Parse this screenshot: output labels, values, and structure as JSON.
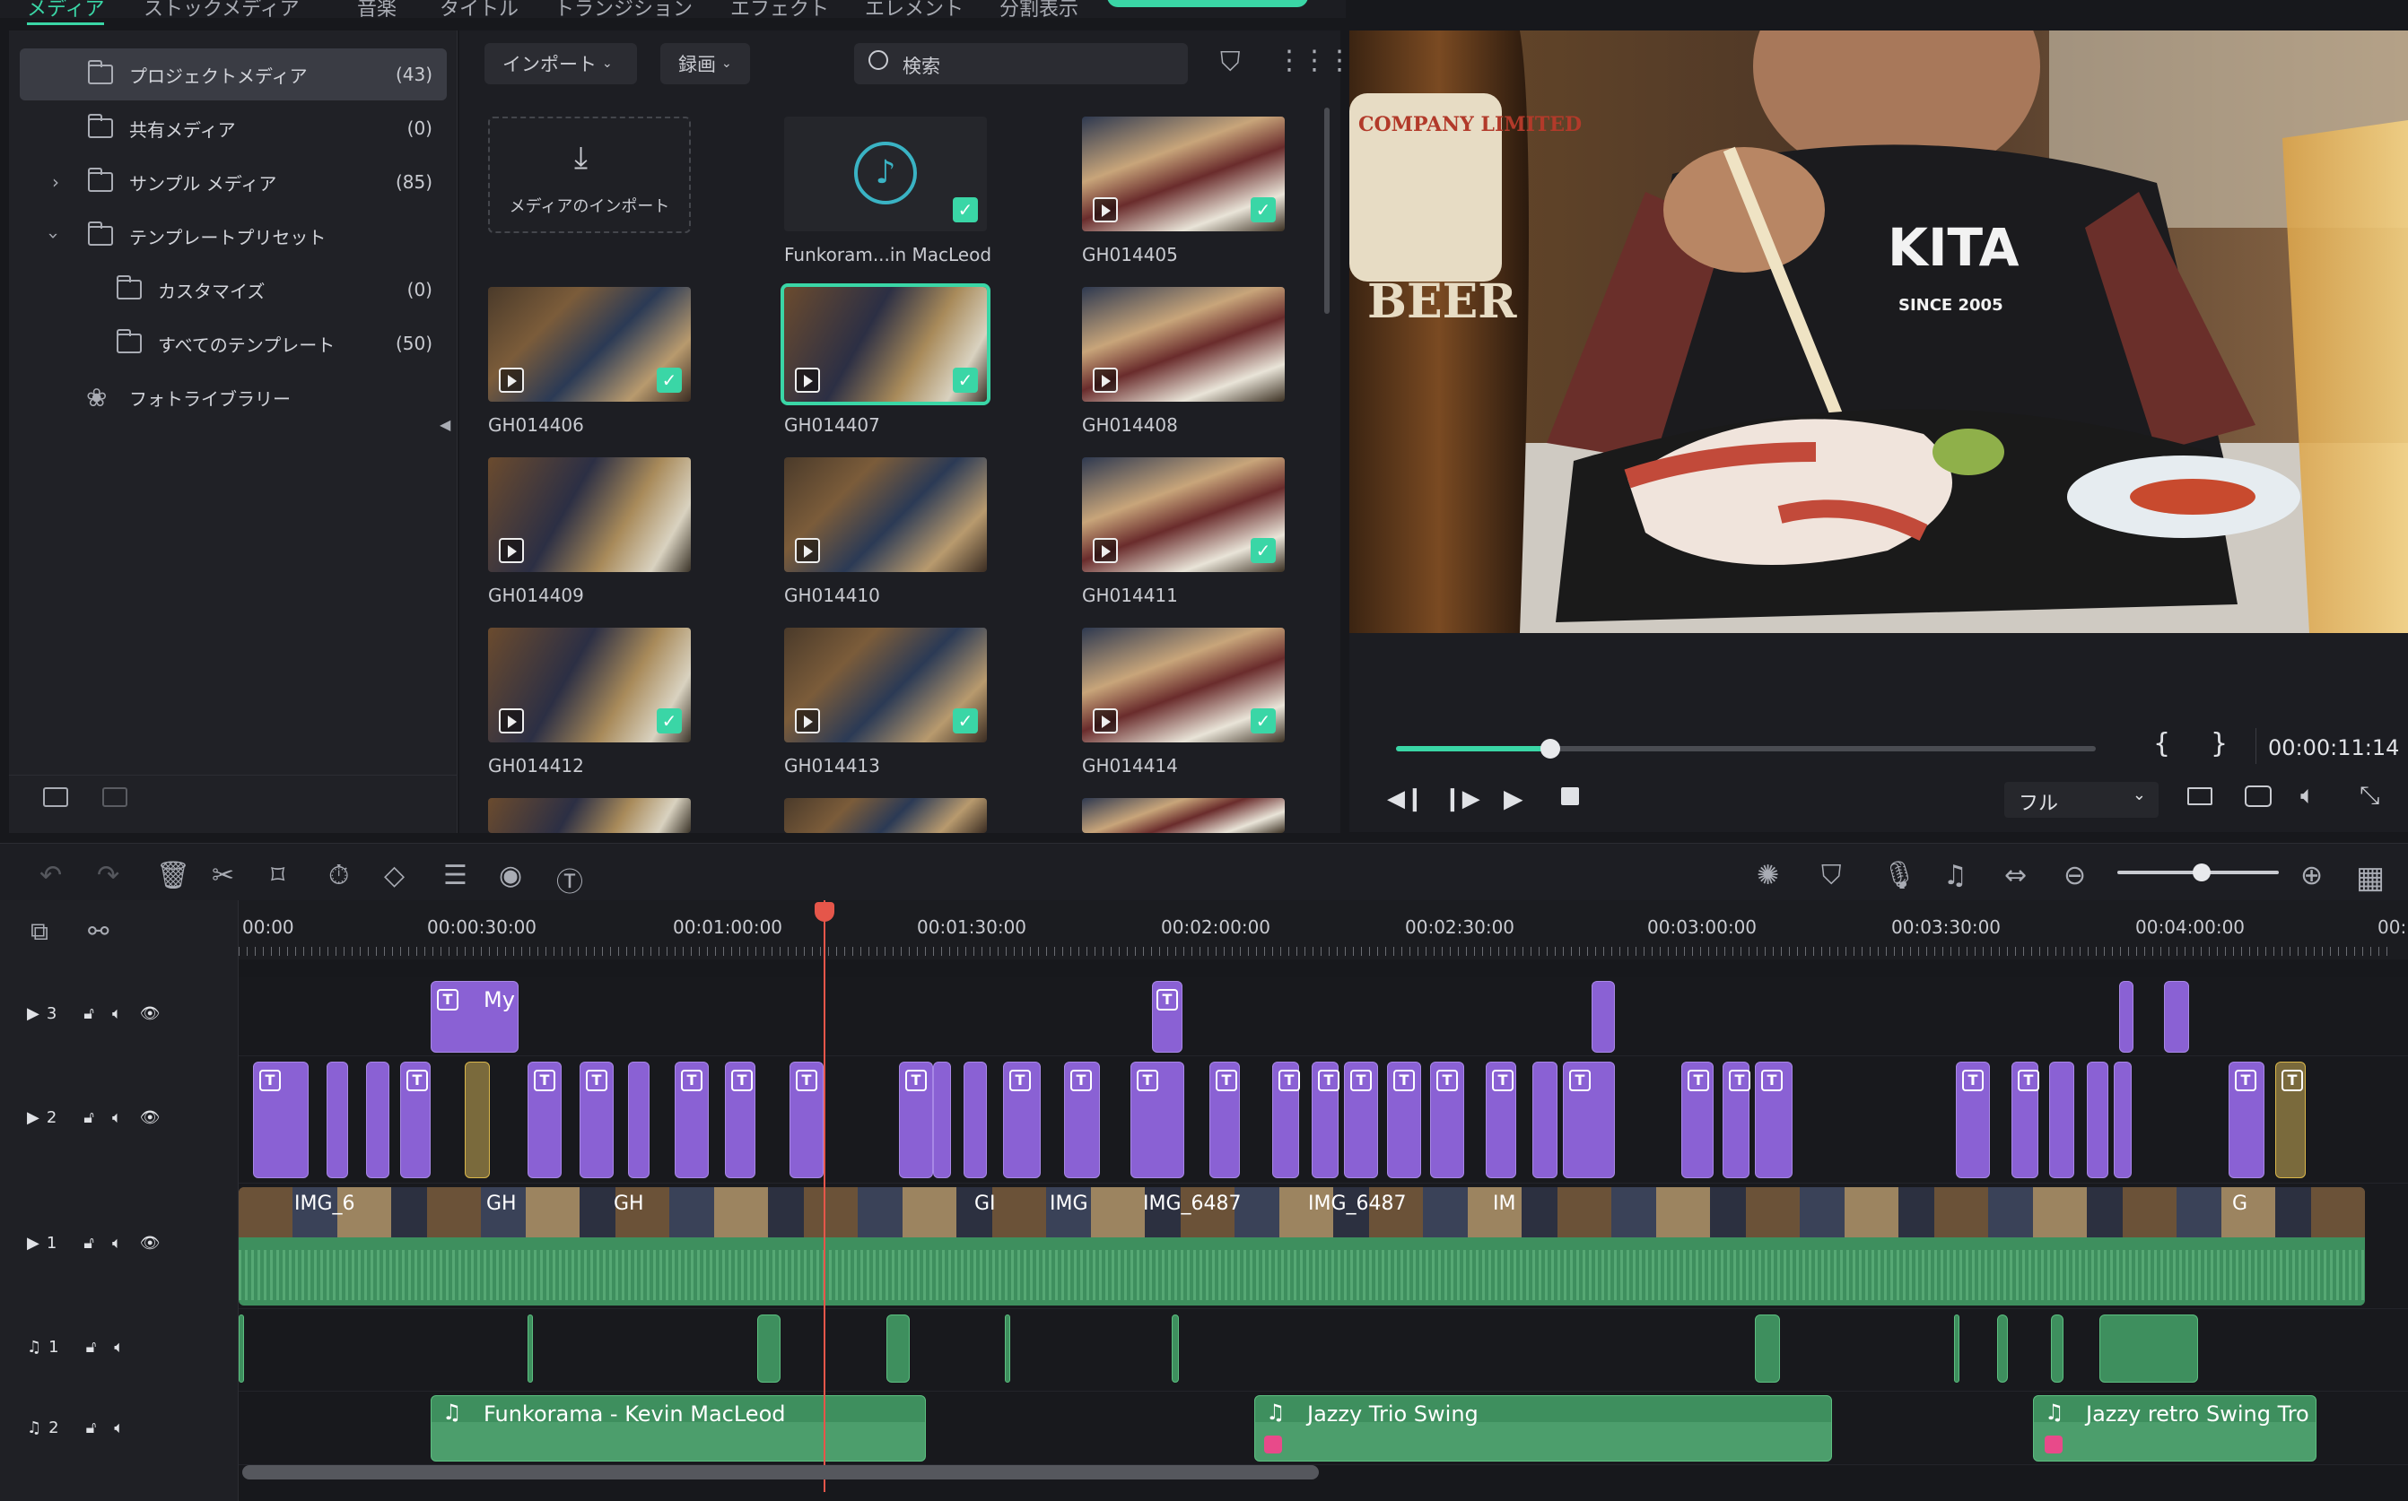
{
  "tabs": [
    "メディア",
    "ストックメディア",
    "音楽",
    "タイトル",
    "トランジション",
    "エフェクト",
    "エレメント",
    "分割表示"
  ],
  "folders": [
    {
      "label": "プロジェクトメディア",
      "count": "(43)"
    },
    {
      "label": "共有メディア",
      "count": "(0)"
    },
    {
      "label": "サンプル メディア",
      "count": "(85)"
    },
    {
      "label": "テンプレートプリセット",
      "count": ""
    },
    {
      "label": "カスタマイズ",
      "count": "(0)"
    },
    {
      "label": "すべてのテンプレート",
      "count": "(50)"
    },
    {
      "label": "フォトライブラリー",
      "count": ""
    }
  ],
  "media_toolbar": {
    "import": "インポート",
    "record": "録画",
    "search_placeholder": "検索"
  },
  "media_items": [
    {
      "label": "メディアのインポート"
    },
    {
      "label": "Funkoram...in MacLeod"
    },
    {
      "label": "GH014405"
    },
    {
      "label": "GH014406"
    },
    {
      "label": "GH014407"
    },
    {
      "label": "GH014408"
    },
    {
      "label": "GH014409"
    },
    {
      "label": "GH014410"
    },
    {
      "label": "GH014411"
    },
    {
      "label": "GH014412"
    },
    {
      "label": "GH014413"
    },
    {
      "label": "GH014414"
    }
  ],
  "preview": {
    "bottle_text": "COMPANY LIMITED",
    "beer_text": "BEER",
    "shirt_text": "KITA",
    "shirt_sub": "SINCE 2005"
  },
  "player": {
    "timecode": "00:00:11:14",
    "quality": "フル",
    "progress": 0.22
  },
  "ruler": [
    "00:00",
    "00:00:30:00",
    "00:01:00:00",
    "00:01:30:00",
    "00:02:00:00",
    "00:02:30:00",
    "00:03:00:00",
    "00:03:30:00",
    "00:04:00:00",
    "00:"
  ],
  "tracks": [
    {
      "id": "3"
    },
    {
      "id": "2"
    },
    {
      "id": "1"
    },
    {
      "id": "1"
    },
    {
      "id": "2"
    }
  ],
  "title_clip_label": "My",
  "video_clip_labels": [
    "IMG_6",
    "GH",
    "GH",
    "GI",
    "IMG",
    "IMG_6487",
    "IMG_6487",
    "IM",
    "G"
  ],
  "audio_clips": [
    "Funkorama - Kevin MacLeod",
    "Jazzy Trio Swing",
    "Jazzy retro Swing Tro"
  ]
}
